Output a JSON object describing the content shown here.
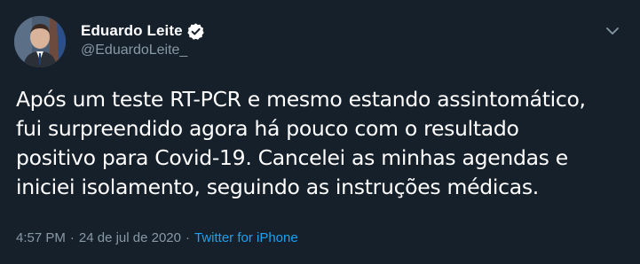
{
  "author": {
    "display_name": "Eduardo Leite",
    "handle": "@EduardoLeite_",
    "verified": true,
    "avatar_icon": "profile-photo"
  },
  "tweet": {
    "text": "Após um teste RT-PCR e mesmo estando assintomático,\nfui surpreendido agora há pouco com o resultado\npositivo para Covid-19. Cancelei as minhas agendas e\niniciei isolamento, seguindo as instruções médicas.",
    "time": "4:57 PM",
    "separator": "·",
    "date": "24 de jul de 2020",
    "source": "Twitter for iPhone"
  },
  "menu_icon": "chevron-down-icon",
  "colors": {
    "background": "#15202b",
    "text_primary": "#ffffff",
    "text_secondary": "#8899a6",
    "accent": "#1da1f2"
  }
}
